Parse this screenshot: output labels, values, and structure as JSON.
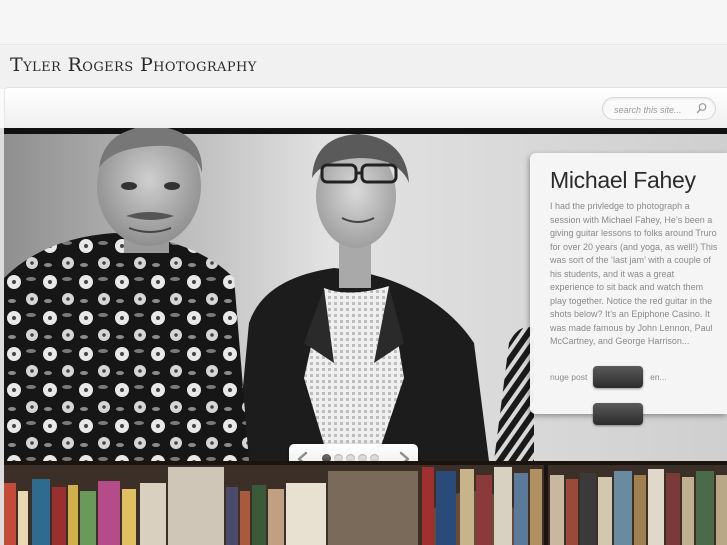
{
  "site": {
    "title": "Tyler Rogers Photography"
  },
  "search": {
    "placeholder": "search this site..."
  },
  "slide": {
    "title": "Michael Fahey",
    "text": "I had the privledge to photograph a session with Michael Fahey, He’s been a giving guitar lessons to folks around Truro for over 20 years (and yoga, as well!) This was sort of the ‘last jam’ with a couple of his students, and it was a great experience to sit back and watch them play together. Notice the red guitar in the shots below? It’s an Epiphone Casino. It was made famous by John Lennon, Paul McCartney, and George Harrison...",
    "tail_left": "nuge post",
    "tail_right": "en..."
  },
  "slider_controls": {
    "slide_count": 5,
    "active_index": 0
  },
  "icons": {
    "search": "search-icon",
    "prev": "chevron-left-icon",
    "next": "chevron-right-icon"
  },
  "colors": {
    "title": "#2a2a2a",
    "caption_text": "#8a8a8a",
    "button_dark": "#2c2c2c"
  }
}
